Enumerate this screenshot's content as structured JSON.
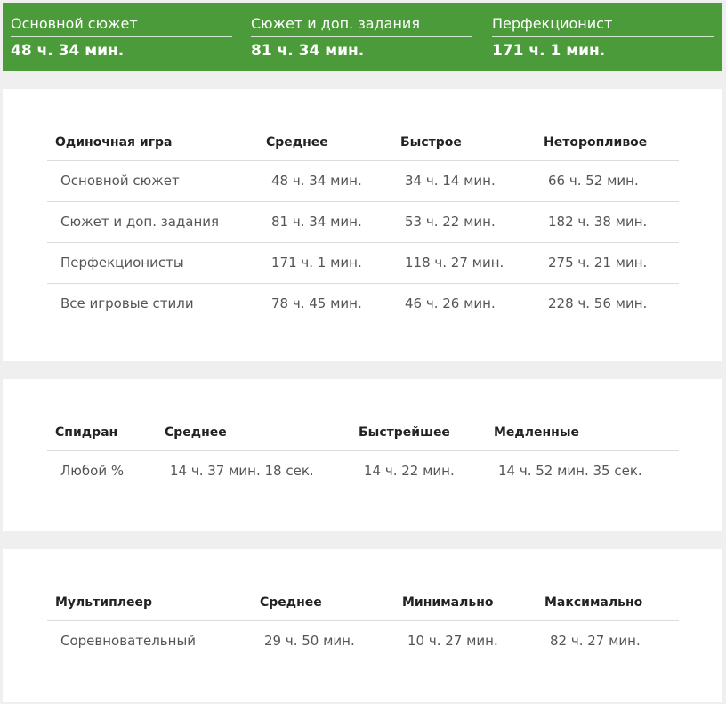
{
  "summary": [
    {
      "label": "Основной сюжет",
      "value": "48 ч. 34 мин."
    },
    {
      "label": "Сюжет и доп. задания",
      "value": "81 ч. 34 мин."
    },
    {
      "label": "Перфекционист",
      "value": "171 ч. 1 мин."
    }
  ],
  "single": {
    "headers": [
      "Одиночная игра",
      "Среднее",
      "Быстрое",
      "Неторопливое"
    ],
    "rows": [
      [
        "Основной сюжет",
        "48 ч. 34 мин.",
        "34 ч. 14 мин.",
        "66 ч. 52 мин."
      ],
      [
        "Сюжет и доп. задания",
        "81 ч. 34 мин.",
        "53 ч. 22 мин.",
        "182 ч. 38 мин."
      ],
      [
        "Перфекционисты",
        "171 ч. 1 мин.",
        "118 ч. 27 мин.",
        "275 ч. 21 мин."
      ],
      [
        "Все игровые стили",
        "78 ч. 45 мин.",
        "46 ч. 26 мин.",
        "228 ч. 56 мин."
      ]
    ]
  },
  "speedrun": {
    "headers": [
      "Спидран",
      "Среднее",
      "Быстрейшее",
      "Медленные"
    ],
    "rows": [
      [
        "Любой %",
        "14 ч. 37 мин. 18 сек.",
        "14 ч. 22 мин.",
        "14 ч. 52 мин. 35 сек."
      ]
    ]
  },
  "multiplayer": {
    "headers": [
      "Мультиплеер",
      "Среднее",
      "Минимально",
      "Максимально"
    ],
    "rows": [
      [
        "Соревновательный",
        "29 ч. 50 мин.",
        "10 ч. 27 мин.",
        "82 ч. 27 мин."
      ]
    ]
  }
}
